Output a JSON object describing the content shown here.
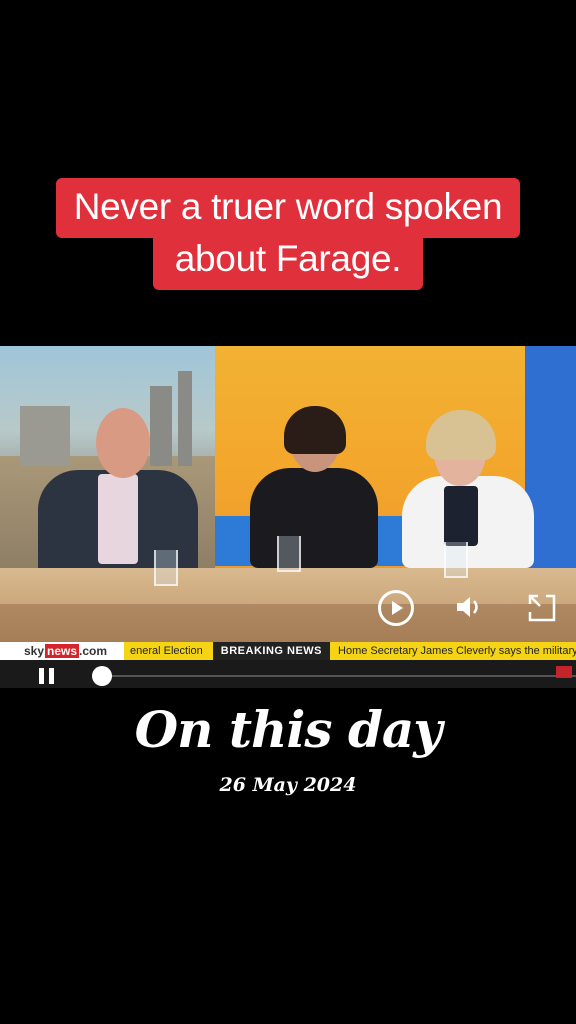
{
  "caption": {
    "line1": "Never a truer word spoken",
    "line2": "about Farage."
  },
  "video": {
    "ticker": {
      "brand_sky": "sky",
      "brand_news": "news",
      "brand_com": ".com",
      "segment_1": "eneral Election",
      "breaking_label": "BREAKING NEWS",
      "headline": "Home Secretary James Cleverly says the military"
    },
    "controls": {
      "replay_icon": "replay-icon",
      "volume_icon": "volume-icon",
      "expand_icon": "expand-icon",
      "pause_icon": "pause-icon"
    },
    "progress": 0.02
  },
  "footer": {
    "title": "On this day",
    "date": "26 May 2024"
  },
  "colors": {
    "caption_bg": "#e0303c",
    "ticker_yellow": "#f5d416",
    "ticker_dark": "#222222",
    "sky_red": "#d6242c"
  }
}
